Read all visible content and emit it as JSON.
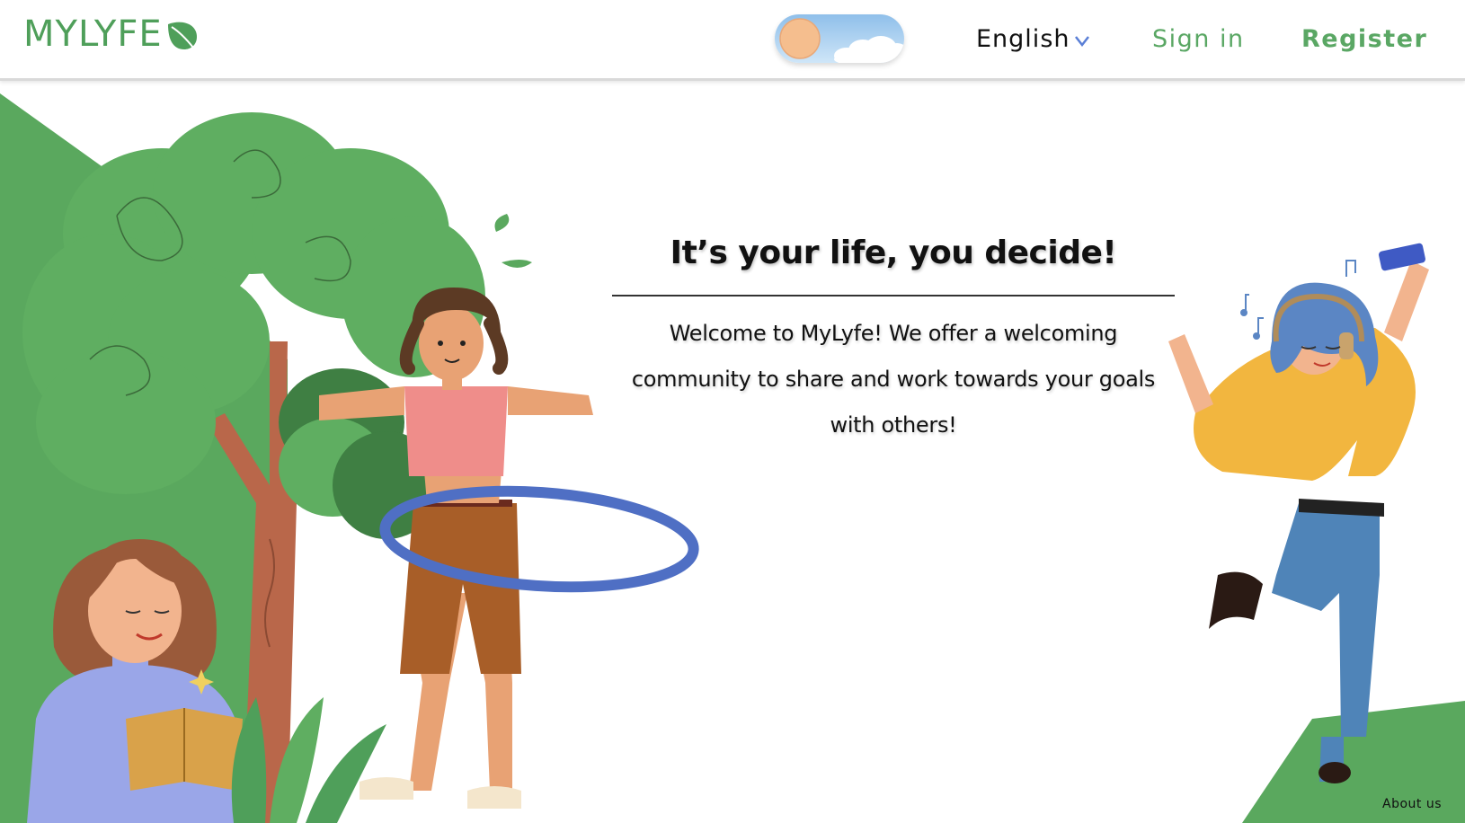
{
  "header": {
    "logo_text": "MYLYFE",
    "theme_toggle_mode": "light",
    "language": "English",
    "signin_label": "Sign in",
    "register_label": "Register"
  },
  "hero": {
    "title": "It’s your life, you decide!",
    "body": "Welcome to MyLyfe! We offer a welcoming community to share and work towards your goals with others!"
  },
  "footer": {
    "about_label": "About us"
  },
  "icons": {
    "logo": "leaf-icon",
    "language": "chevron-down-icon",
    "theme": "sun-cloud-icon"
  },
  "colors": {
    "brand_green": "#4f9f5a",
    "link_green": "#5aa764",
    "background_green": "#5aa85e",
    "tree_green": "#5fae61",
    "header_border": "#d9d9d9"
  }
}
